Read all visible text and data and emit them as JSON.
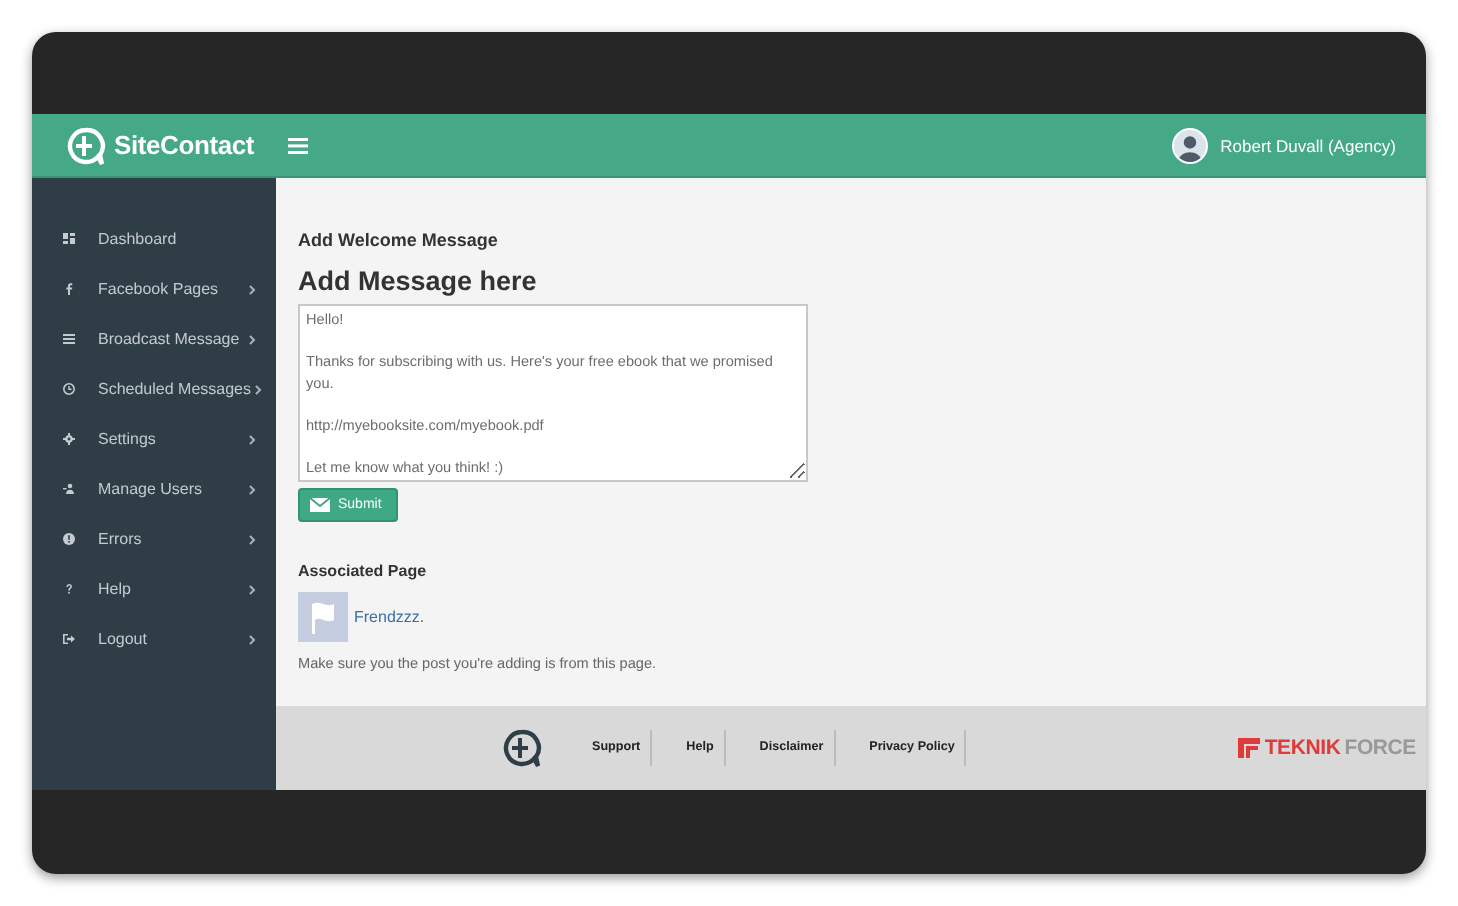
{
  "header": {
    "brand": "SiteContact",
    "user": "Robert Duvall (Agency)"
  },
  "sidebar": {
    "items": [
      {
        "label": "Dashboard",
        "expandable": false
      },
      {
        "label": "Facebook Pages",
        "expandable": true
      },
      {
        "label": "Broadcast Message",
        "expandable": true
      },
      {
        "label": "Scheduled Messages",
        "expandable": true
      },
      {
        "label": "Settings",
        "expandable": true
      },
      {
        "label": "Manage Users",
        "expandable": true
      },
      {
        "label": "Errors",
        "expandable": true
      },
      {
        "label": "Help",
        "expandable": true
      },
      {
        "label": "Logout",
        "expandable": true
      }
    ]
  },
  "content": {
    "section_title": "Add Welcome Message",
    "heading": "Add Message here",
    "message": "Hello!\n\nThanks for subscribing with us. Here's your free ebook that we promised you.\n\nhttp://myebooksite.com/myebook.pdf\n\nLet me know what you think! :)",
    "submit": "Submit",
    "associated_title": "Associated Page",
    "page_name": "Frendzzz.",
    "note": "Make sure you the post you're adding is from this page."
  },
  "footer": {
    "links": [
      "Support",
      "Help",
      "Disclaimer",
      "Privacy Policy"
    ],
    "brand_parts": [
      "TEKNIK",
      "FORCE"
    ]
  }
}
